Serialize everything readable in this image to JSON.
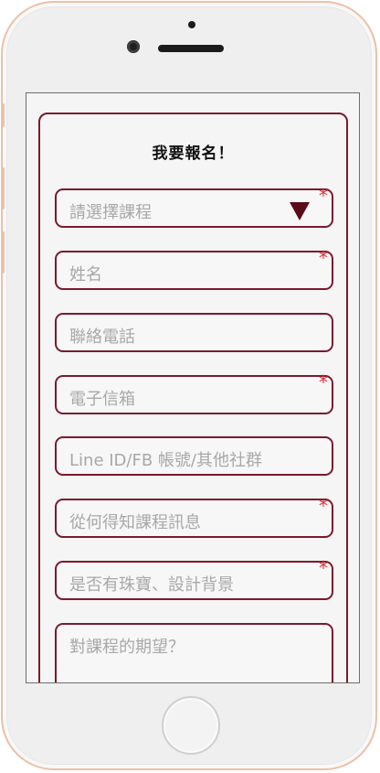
{
  "form": {
    "title": "我要報名！",
    "required_mark": "*",
    "fields": [
      {
        "placeholder": "請選擇課程",
        "required": true,
        "type": "select"
      },
      {
        "placeholder": "姓名",
        "required": true,
        "type": "text"
      },
      {
        "placeholder": "聯絡電話",
        "required": false,
        "type": "text"
      },
      {
        "placeholder": "電子信箱",
        "required": true,
        "type": "text"
      },
      {
        "placeholder": "Line ID/FB 帳號/其他社群",
        "required": false,
        "type": "text"
      },
      {
        "placeholder": "從何得知課程訊息",
        "required": true,
        "type": "text"
      },
      {
        "placeholder": "是否有珠寶、設計背景",
        "required": true,
        "type": "text"
      },
      {
        "placeholder": "對課程的期望？",
        "required": false,
        "type": "textarea"
      }
    ]
  },
  "colors": {
    "accent": "#7b1a2c",
    "required": "#e0303a",
    "placeholder": "#a8a8a8",
    "phone_frame": "#ecc1a9"
  }
}
